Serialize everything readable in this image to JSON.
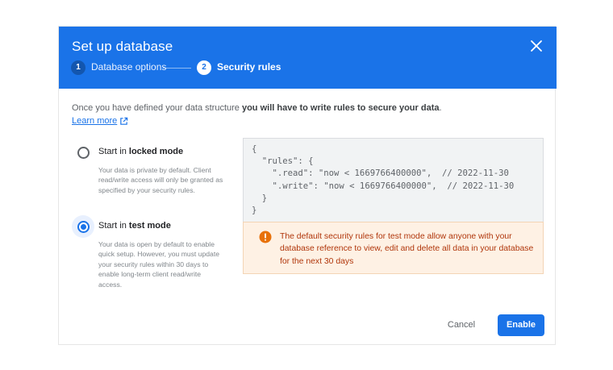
{
  "dialog": {
    "title": "Set up database",
    "steps": [
      {
        "number": "1",
        "label": "Database options"
      },
      {
        "number": "2",
        "label": "Security rules"
      }
    ]
  },
  "intro": {
    "text_plain": "Once you have defined your data structure ",
    "text_bold": "you will have to write rules to secure your data",
    "text_end": ".",
    "learn_more": "Learn more"
  },
  "options": {
    "locked": {
      "prefix": "Start in ",
      "bold": "locked mode",
      "description": "Your data is private by default. Client read/write access will only be granted as specified by your security rules.",
      "selected": false
    },
    "test": {
      "prefix": "Start in ",
      "bold": "test mode",
      "description": "Your data is open by default to enable quick setup. However, you must update your security rules within 30 days to enable long-term client read/write access.",
      "selected": true
    }
  },
  "code": {
    "lines": [
      "{",
      "  \"rules\": {",
      "    \".read\": \"now < 1669766400000\",  // 2022-11-30",
      "    \".write\": \"now < 1669766400000\",  // 2022-11-30",
      "  }",
      "}"
    ]
  },
  "warning": {
    "text": "The default security rules for test mode allow anyone with your database reference to view, edit and delete all data in your database for the next 30 days"
  },
  "actions": {
    "cancel": "Cancel",
    "enable": "Enable"
  },
  "colors": {
    "header": "#1a73e8",
    "warning_bg": "#fef1e4",
    "warning_text": "#b0360b",
    "warning_icon": "#e8710a"
  },
  "icons": [
    "close-icon",
    "external-link-icon",
    "warning-icon"
  ]
}
